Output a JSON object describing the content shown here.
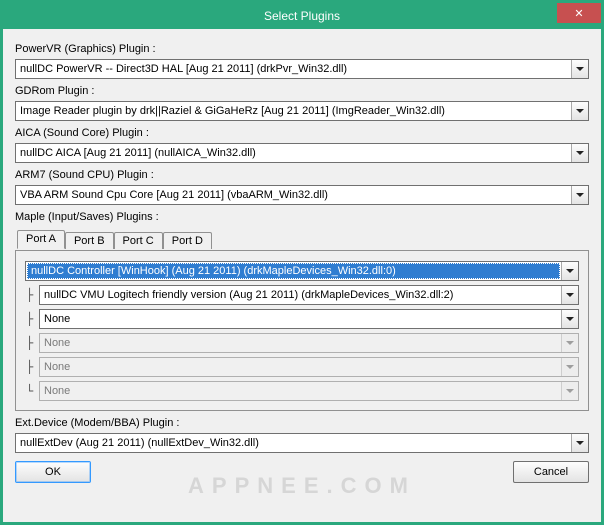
{
  "window": {
    "title": "Select Plugins",
    "close_glyph": "✕"
  },
  "sections": {
    "powervr": {
      "label": "PowerVR (Graphics) Plugin :",
      "value": "nullDC PowerVR -- Direct3D HAL [Aug 21 2011] (drkPvr_Win32.dll)"
    },
    "gdrom": {
      "label": "GDRom Plugin :",
      "value": "Image Reader plugin by drk||Raziel & GiGaHeRz [Aug 21 2011] (ImgReader_Win32.dll)"
    },
    "aica": {
      "label": "AICA (Sound Core) Plugin :",
      "value": "nullDC AICA [Aug 21 2011] (nullAICA_Win32.dll)"
    },
    "arm7": {
      "label": "ARM7 (Sound CPU) Plugin :",
      "value": "VBA ARM Sound Cpu Core [Aug 21 2011] (vbaARM_Win32.dll)"
    },
    "maple": {
      "label": "Maple (Input/Saves) Plugins :"
    },
    "extdev": {
      "label": "Ext.Device (Modem/BBA) Plugin :",
      "value": "nullExtDev (Aug 21 2011) (nullExtDev_Win32.dll)"
    }
  },
  "maple_tabs": {
    "a": "Port A",
    "b": "Port B",
    "c": "Port C",
    "d": "Port D",
    "active": "a"
  },
  "maple_port_a": {
    "main": "nullDC Controller [WinHook] (Aug 21 2011) (drkMapleDevices_Win32.dll:0)",
    "sub1": "nullDC VMU Logitech friendly version (Aug 21 2011) (drkMapleDevices_Win32.dll:2)",
    "sub2": "None",
    "sub3": "None",
    "sub4": "None",
    "sub5": "None"
  },
  "buttons": {
    "ok": "OK",
    "cancel": "Cancel"
  },
  "watermark": "APPNEE.COM"
}
